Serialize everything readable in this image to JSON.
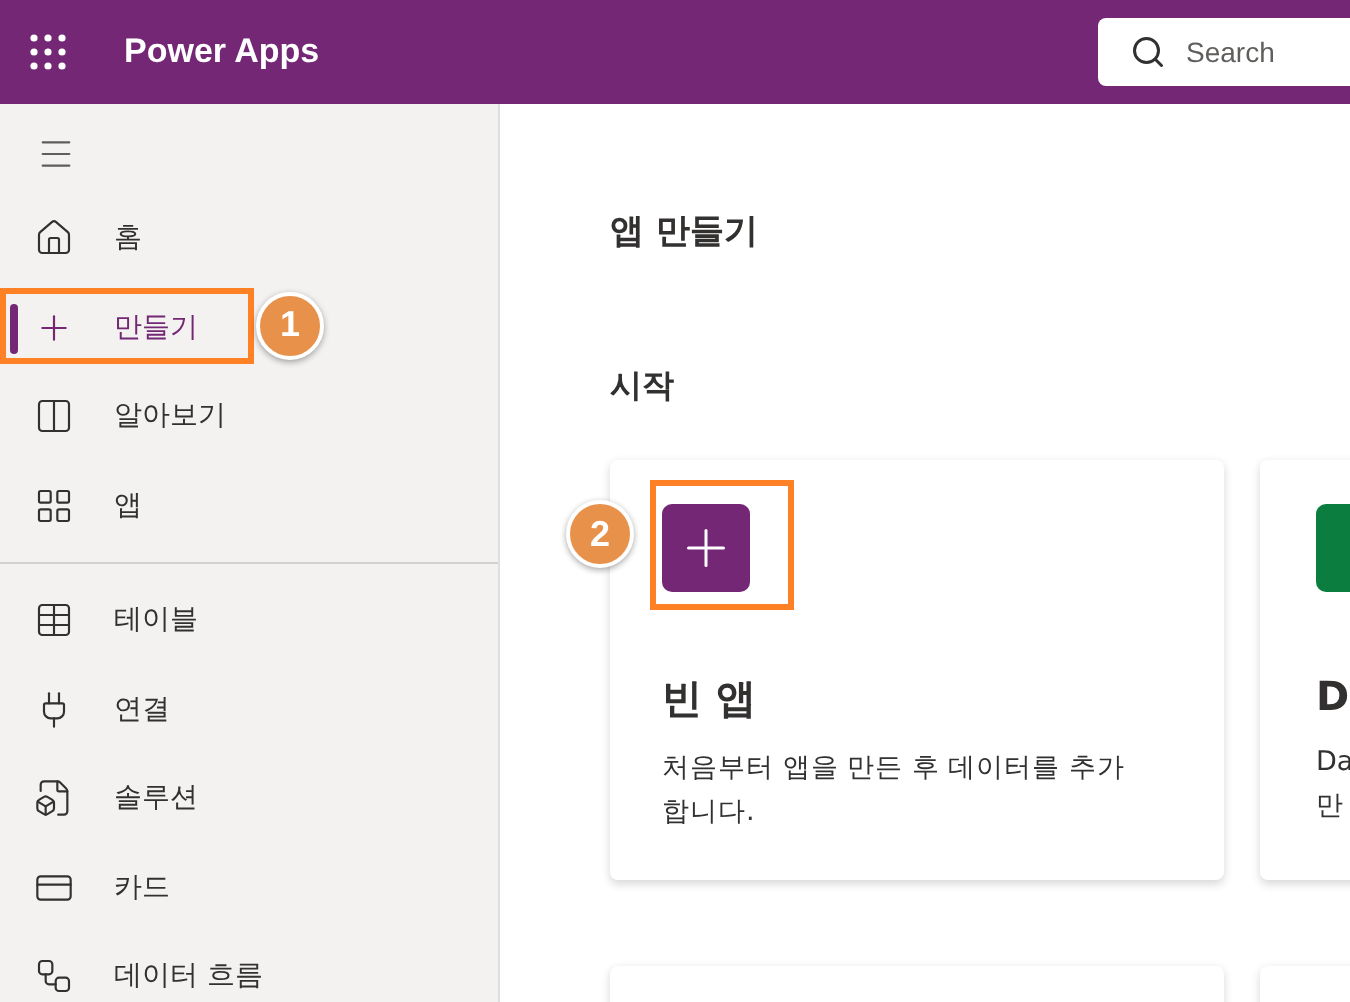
{
  "header": {
    "title": "Power Apps",
    "search": {
      "placeholder": "Search"
    }
  },
  "sidebar": {
    "sections": [
      {
        "items": [
          {
            "label": "홈",
            "selected": false
          },
          {
            "label": "만들기",
            "selected": true
          },
          {
            "label": "알아보기",
            "selected": false
          },
          {
            "label": "앱",
            "selected": false
          }
        ]
      },
      {
        "items": [
          {
            "label": "테이블",
            "selected": false
          },
          {
            "label": "연결",
            "selected": false
          },
          {
            "label": "솔루션",
            "selected": false
          },
          {
            "label": "카드",
            "selected": false
          },
          {
            "label": "데이터 흐름",
            "selected": false
          }
        ]
      }
    ]
  },
  "main": {
    "title": "앱 만들기",
    "section": "시작",
    "cards": [
      {
        "kind": "blank",
        "title": "빈 앱",
        "description": "처음부터 앱을 만든 후 데이터를 추가합니다."
      },
      {
        "kind": "dataverse",
        "title": "D",
        "description_lines": [
          "Da",
          "만"
        ]
      }
    ]
  },
  "annotations": [
    {
      "label": "1"
    },
    {
      "label": "2"
    }
  ]
}
